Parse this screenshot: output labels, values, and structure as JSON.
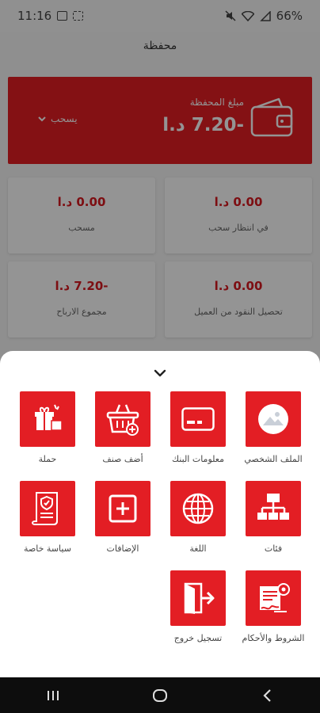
{
  "status_bar": {
    "time": "11:16",
    "battery": "66%"
  },
  "header": {
    "title": "محفظة"
  },
  "wallet": {
    "label": "مبلغ المحفظة",
    "amount": "-7.20 د.ا",
    "withdraw_label": "يسحب"
  },
  "stats": [
    {
      "value": "0.00 د.ا",
      "label": "في انتظار سحب"
    },
    {
      "value": "0.00 د.ا",
      "label": "مسحب"
    },
    {
      "value": "0.00 د.ا",
      "label": "تحصيل النقود من العميل"
    },
    {
      "value": "-7.20 د.ا",
      "label": "مجموع الارباح"
    }
  ],
  "menu": [
    {
      "label": "الملف الشخصي",
      "icon": "profile-image-icon"
    },
    {
      "label": "معلومات البنك",
      "icon": "bank-card-icon"
    },
    {
      "label": "أضف صنف",
      "icon": "add-to-basket-icon"
    },
    {
      "label": "حملة",
      "icon": "campaign-gifts-icon"
    },
    {
      "label": "فئات",
      "icon": "categories-hierarchy-icon"
    },
    {
      "label": "اللغة",
      "icon": "globe-icon"
    },
    {
      "label": "الإضافات",
      "icon": "add-plus-icon"
    },
    {
      "label": "سياسة خاصة",
      "icon": "privacy-policy-icon"
    },
    {
      "label": "الشروط والأحكام",
      "icon": "terms-conditions-icon"
    },
    {
      "label": "تسجيل خروج",
      "icon": "logout-icon"
    }
  ],
  "colors": {
    "accent": "#e31e24",
    "amount_text": "#d71920",
    "nav_bar": "#0d0d0d"
  }
}
